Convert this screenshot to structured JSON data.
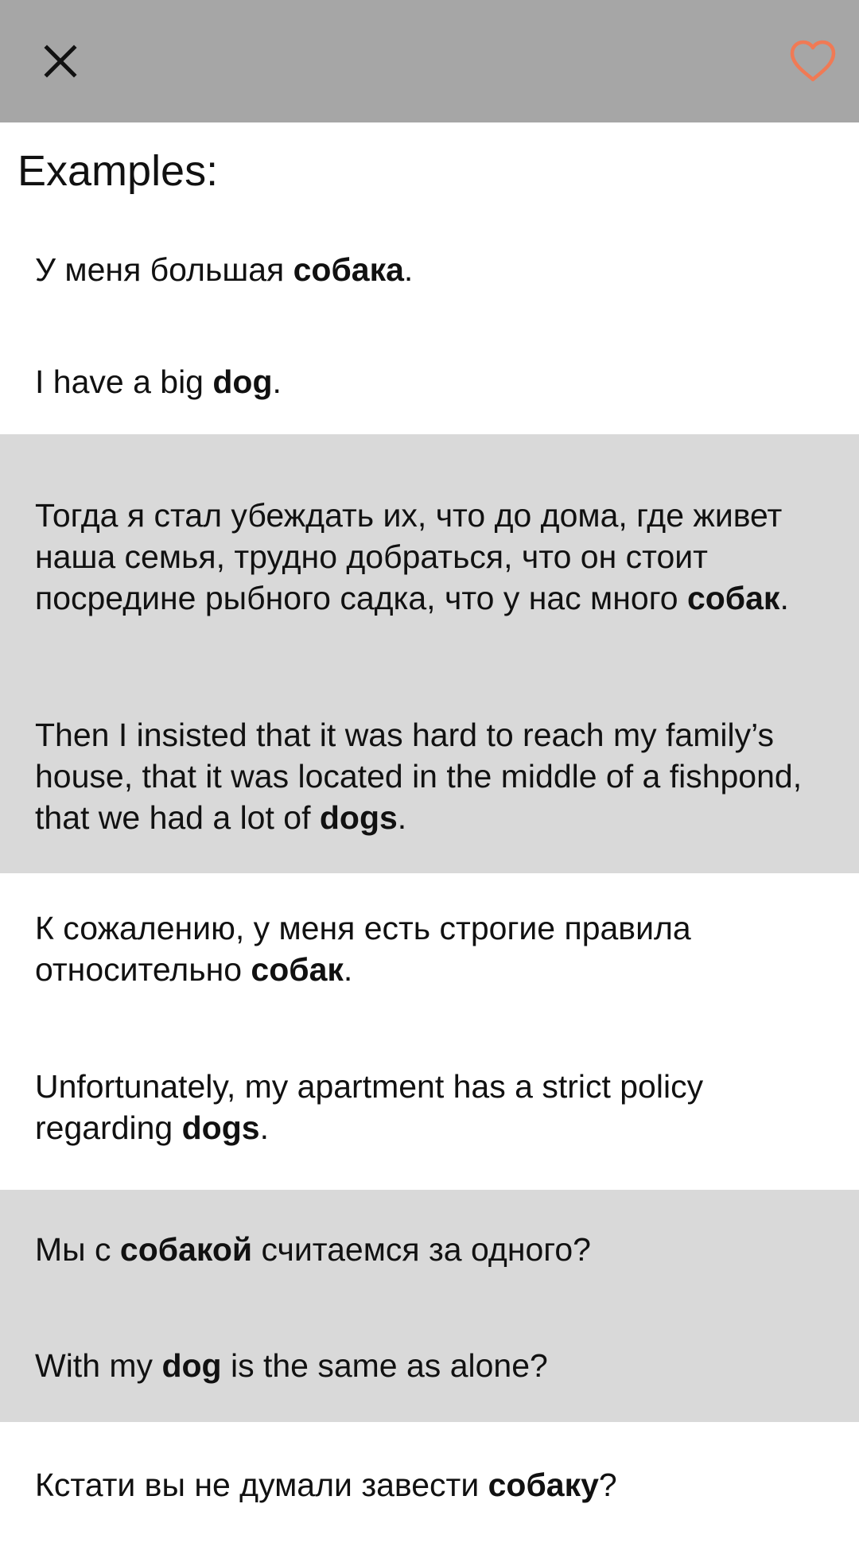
{
  "toolbar": {
    "close_icon": "close-icon",
    "favorite_icon": "heart-outline-icon",
    "favorite_color": "#f07a55",
    "background": "#a6a6a6"
  },
  "heading": "Examples:",
  "shaded_color": "#d9d9d9",
  "examples": [
    {
      "shaded": false,
      "ru": {
        "pre": "У меня большая ",
        "bold": "собака",
        "post": "."
      },
      "en": {
        "pre": "I have a big ",
        "bold": "dog",
        "post": "."
      }
    },
    {
      "shaded": true,
      "ru": {
        "pre": "Тогда я стал убеждать их, что до дома, где живет наша семья, трудно добраться, что он стоит посредине рыбного садка, что у нас много ",
        "bold": "собак",
        "post": "."
      },
      "en": {
        "pre": "Then I insisted that it was hard to reach my family’s house, that it was located in the middle of a fishpond, that we had a lot of ",
        "bold": "dogs",
        "post": "."
      }
    },
    {
      "shaded": false,
      "ru": {
        "pre": "К сожалению, у меня есть строгие правила относительно ",
        "bold": "собак",
        "post": "."
      },
      "en": {
        "pre": "Unfortunately, my apartment has a strict policy regarding ",
        "bold": "dogs",
        "post": "."
      }
    },
    {
      "shaded": true,
      "ru": {
        "pre": "Мы с ",
        "bold": "собакой",
        "post": " считаемся за одного?"
      },
      "en": {
        "pre": "With my ",
        "bold": "dog",
        "post": " is the same as alone?"
      }
    },
    {
      "shaded": false,
      "ru": {
        "pre": "Кстати вы не думали завести ",
        "bold": "собаку",
        "post": "?"
      },
      "en": null
    }
  ]
}
